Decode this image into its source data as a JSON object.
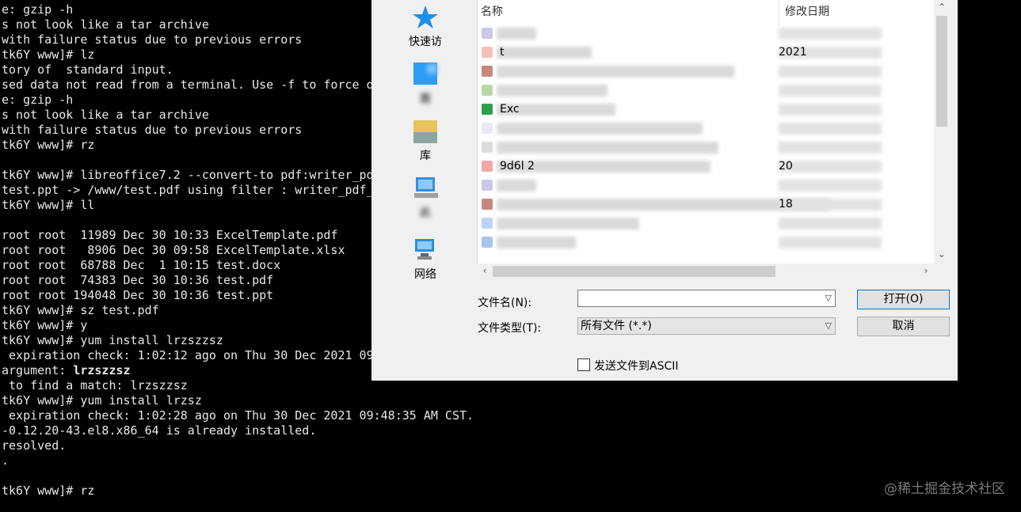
{
  "terminal": {
    "lines": [
      "e: gzip -h",
      "s not look like a tar archive",
      "with failure status due to previous errors",
      "tk6Y www]# lz",
      "tory of  standard input.",
      "sed data not read from a terminal. Use -f to force d",
      "e: gzip -h",
      "s not look like a tar archive",
      "with failure status due to previous errors",
      "tk6Y www]# rz",
      "",
      "tk6Y www]# libreoffice7.2 --convert-to pdf:writer_pd",
      "test.ppt -> /www/test.pdf using filter : writer_pdf_",
      "tk6Y www]# ll",
      "",
      "root root  11989 Dec 30 10:33 ExcelTemplate.pdf",
      "root root   8906 Dec 30 09:58 ExcelTemplate.xlsx",
      "root root  68788 Dec  1 10:15 test.docx",
      "root root  74383 Dec 30 10:36 test.pdf",
      "root root 194048 Dec 30 10:36 test.ppt",
      "tk6Y www]# sz test.pdf",
      "tk6Y www]# y",
      "tk6Y www]# yum install lrzszzsz",
      " expiration check: 1:02:12 ago on Thu 30 Dec 2021 09",
      "argument: ",
      " to find a match: lrzszzsz",
      "tk6Y www]# yum install lrzsz",
      " expiration check: 1:02:28 ago on Thu 30 Dec 2021 09:48:35 AM CST.",
      "-0.12.20-43.el8.x86_64 is already installed.",
      "resolved.",
      ".",
      "",
      "tk6Y www]# rz"
    ],
    "bold_suffix_line": 24,
    "bold_suffix": "lrzszzsz"
  },
  "watermark": "@稀土掘金技术社区",
  "dialog": {
    "places": [
      {
        "label": "快速访",
        "icon": "star-icon"
      },
      {
        "label": "面",
        "icon": "desktop-icon"
      },
      {
        "label": "库",
        "icon": "library-icon"
      },
      {
        "label": "此",
        "icon": "this-pc-icon"
      },
      {
        "label": "网络",
        "icon": "network-icon"
      }
    ],
    "columns": {
      "name": "名称",
      "date": "修改日期"
    },
    "rows": [
      {
        "name": "",
        "date": ""
      },
      {
        "name": "t",
        "date": "2021"
      },
      {
        "name": "",
        "date": ""
      },
      {
        "name": "",
        "date": ""
      },
      {
        "name": "Exc",
        "date": ""
      },
      {
        "name": "",
        "date": ""
      },
      {
        "name": "",
        "date": ""
      },
      {
        "name": "9d6l 2",
        "date": "20"
      },
      {
        "name": "",
        "date": ""
      },
      {
        "name": "",
        "date": "18"
      },
      {
        "name": "",
        "date": ""
      },
      {
        "name": "",
        "date": ""
      }
    ],
    "filename_label": "文件名(N):",
    "filename_value": "",
    "filetype_label": "文件类型(T):",
    "filetype_value": "所有文件 (*.*)",
    "open_button": "打开(O)",
    "cancel_button": "取消",
    "ascii_label": "发送文件到ASCII",
    "ascii_checked": false
  }
}
